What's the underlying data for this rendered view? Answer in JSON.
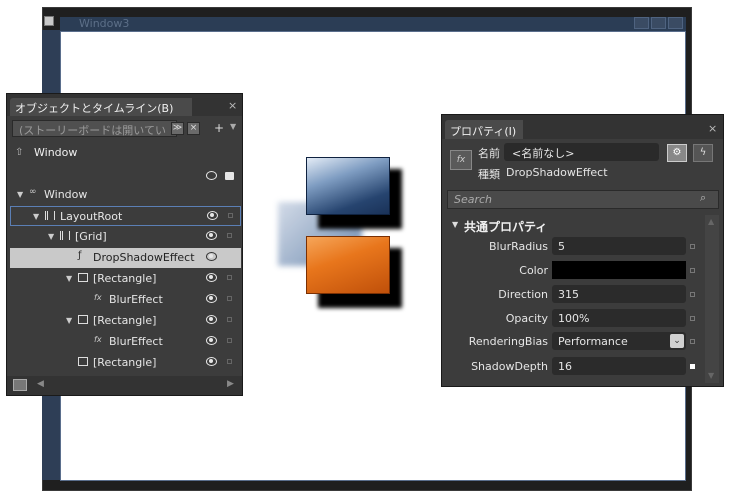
{
  "window": {
    "title": "Window3"
  },
  "objects_panel": {
    "tab_title": "オブジェクトとタイムライン(B)",
    "close": "×",
    "search_placeholder": "(ストーリーボードは開いてい",
    "root_label": "Window",
    "tree": [
      {
        "label": "Window",
        "expander": "▼",
        "icon": "window-icon",
        "eye": false,
        "mark": false
      },
      {
        "label": "LayoutRoot",
        "expander": "▼",
        "icon": "grid-icon",
        "eye": true,
        "mark": true,
        "selected_outline": true
      },
      {
        "label": "[Grid]",
        "expander": "▼",
        "icon": "grid-icon",
        "eye": true,
        "mark": true
      },
      {
        "label": "DropShadowEffect",
        "expander": "",
        "icon": "effect-icon",
        "eye": true,
        "mark": false,
        "highlighted": true
      },
      {
        "label": "[Rectangle]",
        "expander": "▼",
        "icon": "rectangle-icon",
        "eye": true,
        "mark": true
      },
      {
        "label": "BlurEffect",
        "expander": "",
        "icon": "fx-icon",
        "eye": true,
        "mark": true
      },
      {
        "label": "[Rectangle]",
        "expander": "▼",
        "icon": "rectangle-icon",
        "eye": true,
        "mark": true
      },
      {
        "label": "BlurEffect",
        "expander": "",
        "icon": "fx-icon",
        "eye": true,
        "mark": true
      },
      {
        "label": "[Rectangle]",
        "expander": "",
        "icon": "rectangle-icon",
        "eye": true,
        "mark": true
      }
    ]
  },
  "properties_panel": {
    "tab_title": "プロパティ(I)",
    "close": "×",
    "name_label": "名前",
    "name_value": "<名前なし>",
    "type_label": "種類",
    "type_value": "DropShadowEffect",
    "search_placeholder": "Search",
    "category": "共通プロパティ",
    "properties": [
      {
        "label": "BlurRadius",
        "value": "5",
        "kind": "text"
      },
      {
        "label": "Color",
        "value": "",
        "kind": "color",
        "color": "#000000"
      },
      {
        "label": "Direction",
        "value": "315",
        "kind": "text"
      },
      {
        "label": "Opacity",
        "value": "100%",
        "kind": "text"
      },
      {
        "label": "RenderingBias",
        "value": "Performance",
        "kind": "select"
      },
      {
        "label": "ShadowDepth",
        "value": "16",
        "kind": "text",
        "mark_filled": true
      }
    ]
  },
  "colors": {
    "accent_blue": "#1f3a66",
    "accent_orange": "#e36a12",
    "panel_bg": "#3c3c3c"
  }
}
